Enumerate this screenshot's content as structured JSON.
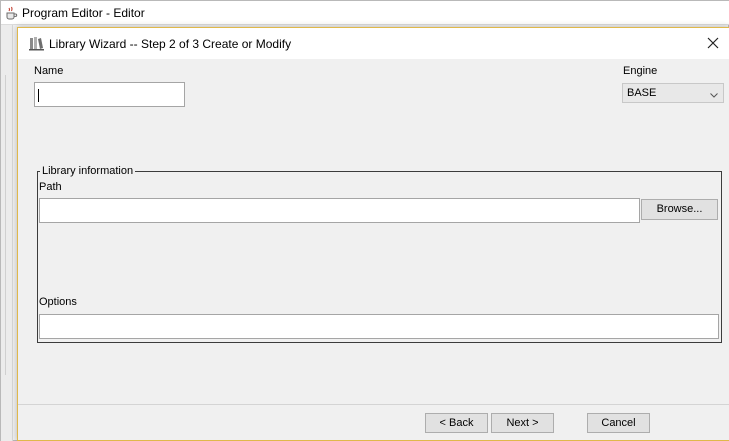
{
  "outer_window": {
    "title": "Program Editor - Editor",
    "icon": "java-cup-icon"
  },
  "dialog": {
    "title": "Library Wizard  -- Step 2 of 3  Create or Modify",
    "icon": "library-wizard-icon",
    "close_icon": "close-icon"
  },
  "form": {
    "name_label": "Name",
    "name_value": "",
    "engine_label": "Engine",
    "engine_value": "BASE",
    "group_title": "Library information",
    "path_label": "Path",
    "path_value": "",
    "browse_label": "Browse...",
    "options_label": "Options",
    "options_value": ""
  },
  "buttons": {
    "back_label": "< Back",
    "next_label": "Next >",
    "cancel_label": "Cancel"
  }
}
